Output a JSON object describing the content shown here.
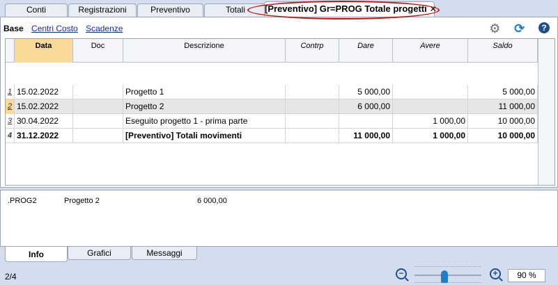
{
  "tabs": [
    {
      "label": "Conti"
    },
    {
      "label": "Registrazioni"
    },
    {
      "label": "Preventivo"
    },
    {
      "label": "Totali"
    },
    {
      "label": "[Preventivo] Gr=PROG Totale progetti",
      "close": "✕"
    }
  ],
  "subnav": {
    "current": "Base",
    "links": [
      "Centri Costo",
      "Scadenze"
    ]
  },
  "icons": [
    "gear-icon",
    "refresh-icon",
    "help-icon"
  ],
  "table": {
    "columns": [
      "Data",
      "Doc",
      "Descrizione",
      "Contrp",
      "Dare",
      "Avere",
      "Saldo"
    ],
    "rows": [
      {
        "num": "1",
        "data": "15.02.2022",
        "doc": "",
        "descr": "Progetto 1",
        "contrp": "",
        "dare": "5 000,00",
        "avere": "",
        "saldo": "5 000,00"
      },
      {
        "num": "2",
        "data": "15.02.2022",
        "doc": "",
        "descr": "Progetto 2",
        "contrp": "",
        "dare": "6 000,00",
        "avere": "",
        "saldo": "11 000,00"
      },
      {
        "num": "3",
        "data": "30.04.2022",
        "doc": "",
        "descr": "Eseguito progetto 1 - prima parte",
        "contrp": "",
        "dare": "",
        "avere": "1 000,00",
        "saldo": "10 000,00"
      },
      {
        "num": "4",
        "data": "31.12.2022",
        "doc": "",
        "descr": "[Preventivo] Totali movimenti",
        "contrp": "",
        "dare": "11 000,00",
        "avere": "1 000,00",
        "saldo": "10 000,00"
      }
    ]
  },
  "info": {
    "account": ".PROG2",
    "description": "Progetto 2",
    "amount": "6 000,00"
  },
  "bottom_tabs": [
    "Info",
    "Grafici",
    "Messaggi"
  ],
  "status": {
    "position": "2/4",
    "zoom": "90  %"
  }
}
